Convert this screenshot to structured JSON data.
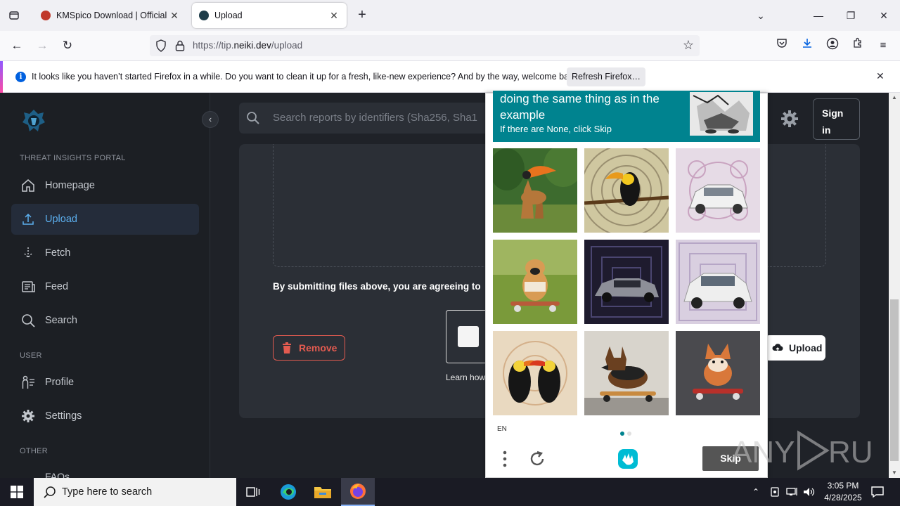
{
  "browser": {
    "tabs": [
      {
        "title": "KMSpico Download | Official K",
        "active": false
      },
      {
        "title": "Upload",
        "active": true
      }
    ],
    "url_prefix": "https://tip.",
    "url_domain": "neiki.dev",
    "url_path": "/upload",
    "notification": {
      "message": "It looks like you haven’t started Firefox in a while. Do you want to clean it up for a fresh, like-new experience? And by the way, welcome back!",
      "button": "Refresh Firefox…"
    }
  },
  "sidebar": {
    "section_portal": "THREAT INSIGHTS PORTAL",
    "items": [
      {
        "label": "Homepage",
        "icon": "home-icon"
      },
      {
        "label": "Upload",
        "icon": "upload-icon",
        "active": true
      },
      {
        "label": "Fetch",
        "icon": "fetch-icon"
      },
      {
        "label": "Feed",
        "icon": "feed-icon"
      },
      {
        "label": "Search",
        "icon": "search-icon"
      }
    ],
    "section_user": "USER",
    "user_items": [
      {
        "label": "Profile",
        "icon": "profile-icon"
      },
      {
        "label": "Settings",
        "icon": "gear-icon"
      }
    ],
    "section_other": "OTHER",
    "other_partial": "FAQs"
  },
  "header": {
    "search_placeholder": "Search reports by identifiers (Sha256, Sha1",
    "signin_line1": "Sign",
    "signin_line2": "in"
  },
  "upload": {
    "terms": "By submitting files above, you are agreeing to",
    "remove": "Remove",
    "learn": "Learn how",
    "upload": "Upload"
  },
  "captcha": {
    "prompt": "doing the same thing as in the example",
    "sub": "If there are None, click Skip",
    "lang": "EN",
    "skip": "Skip",
    "images": [
      "giraffe-toucan",
      "toucan-pattern",
      "car-pattern",
      "dog-skateboard",
      "car-dark",
      "car-white",
      "toucans-pair",
      "shepherd-skateboard",
      "shiba-skateboard"
    ]
  },
  "taskbar": {
    "search_placeholder": "Type here to search",
    "time": "3:05 PM",
    "date": "4/28/2025"
  },
  "watermark": "ANY RUN"
}
